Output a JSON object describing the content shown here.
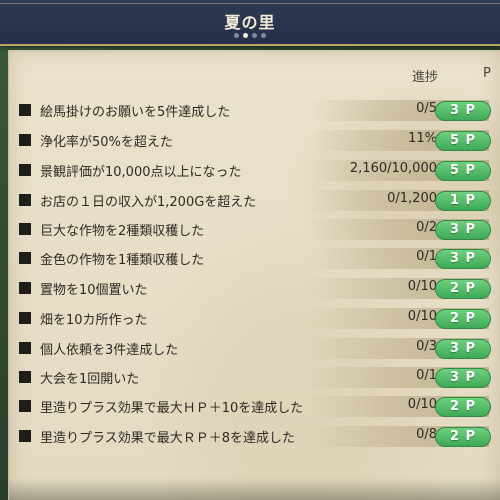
{
  "header": {
    "title": "夏の里",
    "page_count": 4,
    "page_current": 2
  },
  "columns": {
    "progress": "進捗",
    "points": "P"
  },
  "colors": {
    "header_bg": "#243049",
    "panel_bg": "#e8dec6",
    "points_badge": "#4cb862"
  },
  "goals": [
    {
      "label": "絵馬掛けのお願いを5件達成した",
      "progress": "0/5",
      "points": "3 P"
    },
    {
      "label": "浄化率が50%を超えた",
      "progress": "11%",
      "points": "5 P"
    },
    {
      "label": "景観評価が10,000点以上になった",
      "progress": "2,160/10,000",
      "points": "5 P"
    },
    {
      "label": "お店の１日の収入が1,200Gを超えた",
      "progress": "0/1,200",
      "points": "1 P"
    },
    {
      "label": "巨大な作物を2種類収穫した",
      "progress": "0/2",
      "points": "3 P"
    },
    {
      "label": "金色の作物を1種類収穫した",
      "progress": "0/1",
      "points": "3 P"
    },
    {
      "label": "置物を10個置いた",
      "progress": "0/10",
      "points": "2 P"
    },
    {
      "label": "畑を10カ所作った",
      "progress": "0/10",
      "points": "2 P"
    },
    {
      "label": "個人依頼を3件達成した",
      "progress": "0/3",
      "points": "3 P"
    },
    {
      "label": "大会を1回開いた",
      "progress": "0/1",
      "points": "3 P"
    },
    {
      "label": "里造りプラス効果で最大ＨＰ＋10を達成した",
      "progress": "0/10",
      "points": "2 P"
    },
    {
      "label": "里造りプラス効果で最大ＲＰ＋8を達成した",
      "progress": "0/8",
      "points": "2 P"
    }
  ]
}
